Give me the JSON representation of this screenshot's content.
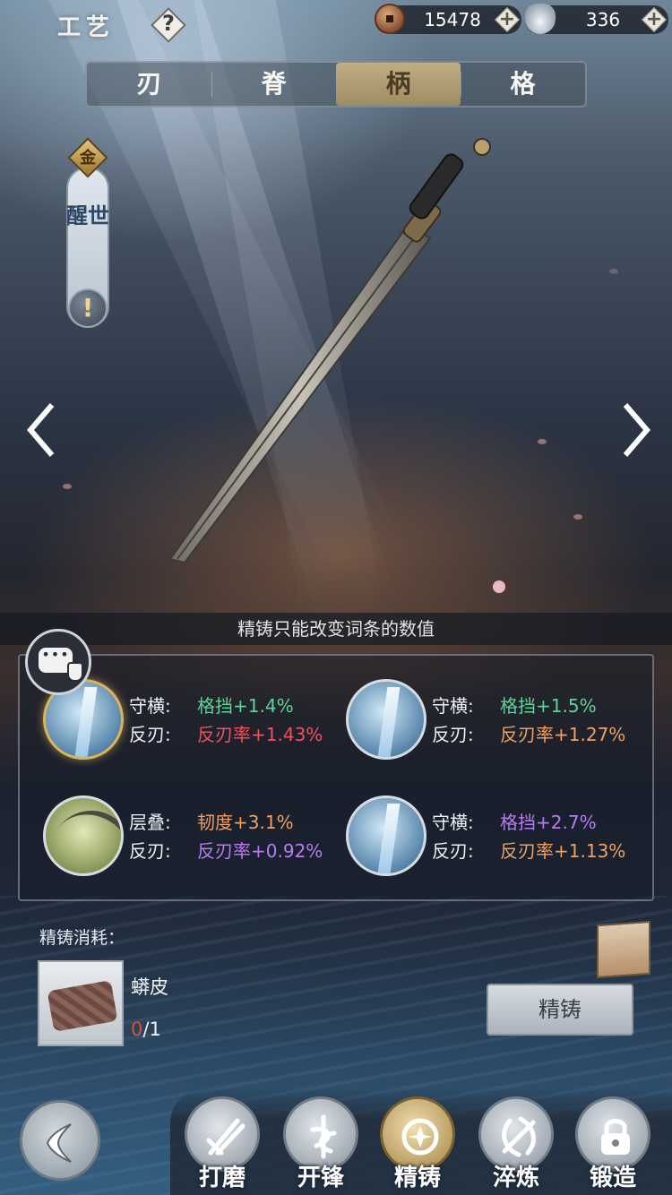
{
  "header": {
    "title": "工艺",
    "help_label": "?",
    "coins": "15478",
    "silver": "336",
    "plus_label": "+"
  },
  "tabs": [
    {
      "label": "刃",
      "active": false
    },
    {
      "label": "脊",
      "active": false
    },
    {
      "label": "柄",
      "active": true
    },
    {
      "label": "格",
      "active": false
    }
  ],
  "weapon": {
    "grade_badge": "金",
    "name": "醒世",
    "info_label": "!"
  },
  "hint": "精铸只能改变词条的数值",
  "colors": {
    "green": "#5fd39a",
    "red": "#f0525a",
    "orange": "#f0a060",
    "purple": "#b87cf0",
    "accent_gold": "#c0ae84"
  },
  "entries": [
    {
      "icon": "ice-blade-icon",
      "selected": true,
      "k1": "守横:",
      "v1": "格挡+1.4%",
      "v1_color": "#5fd39a",
      "k2": "反刃:",
      "v2": "反刃率+1.43%",
      "v2_color": "#f0525a"
    },
    {
      "icon": "ice-blade-icon",
      "selected": false,
      "k1": "守横:",
      "v1": "格挡+1.5%",
      "v1_color": "#5fd39a",
      "k2": "反刃:",
      "v2": "反刃率+1.27%",
      "v2_color": "#f0a060"
    },
    {
      "icon": "tough-layer-icon",
      "selected": false,
      "k1": "层叠:",
      "v1": "韧度+3.1%",
      "v1_color": "#f0a060",
      "k2": "反刃:",
      "v2": "反刃率+0.92%",
      "v2_color": "#b87cf0"
    },
    {
      "icon": "ice-blade-icon",
      "selected": false,
      "k1": "守横:",
      "v1": "格挡+2.7%",
      "v1_color": "#b87cf0",
      "k2": "反刃:",
      "v2": "反刃率+1.13%",
      "v2_color": "#f0a060"
    }
  ],
  "cost": {
    "label": "精铸消耗：",
    "material_name": "蟒皮",
    "have": "0",
    "need": "/1"
  },
  "forge_button": "精铸",
  "nav": [
    {
      "label": "打磨",
      "icon": "grind-icon",
      "active": false
    },
    {
      "label": "开锋",
      "icon": "sharpen-icon",
      "active": false
    },
    {
      "label": "精铸",
      "icon": "refine-icon",
      "active": true
    },
    {
      "label": "淬炼",
      "icon": "temper-icon",
      "active": false
    },
    {
      "label": "锻造",
      "icon": "forge-lock-icon",
      "active": false
    }
  ]
}
